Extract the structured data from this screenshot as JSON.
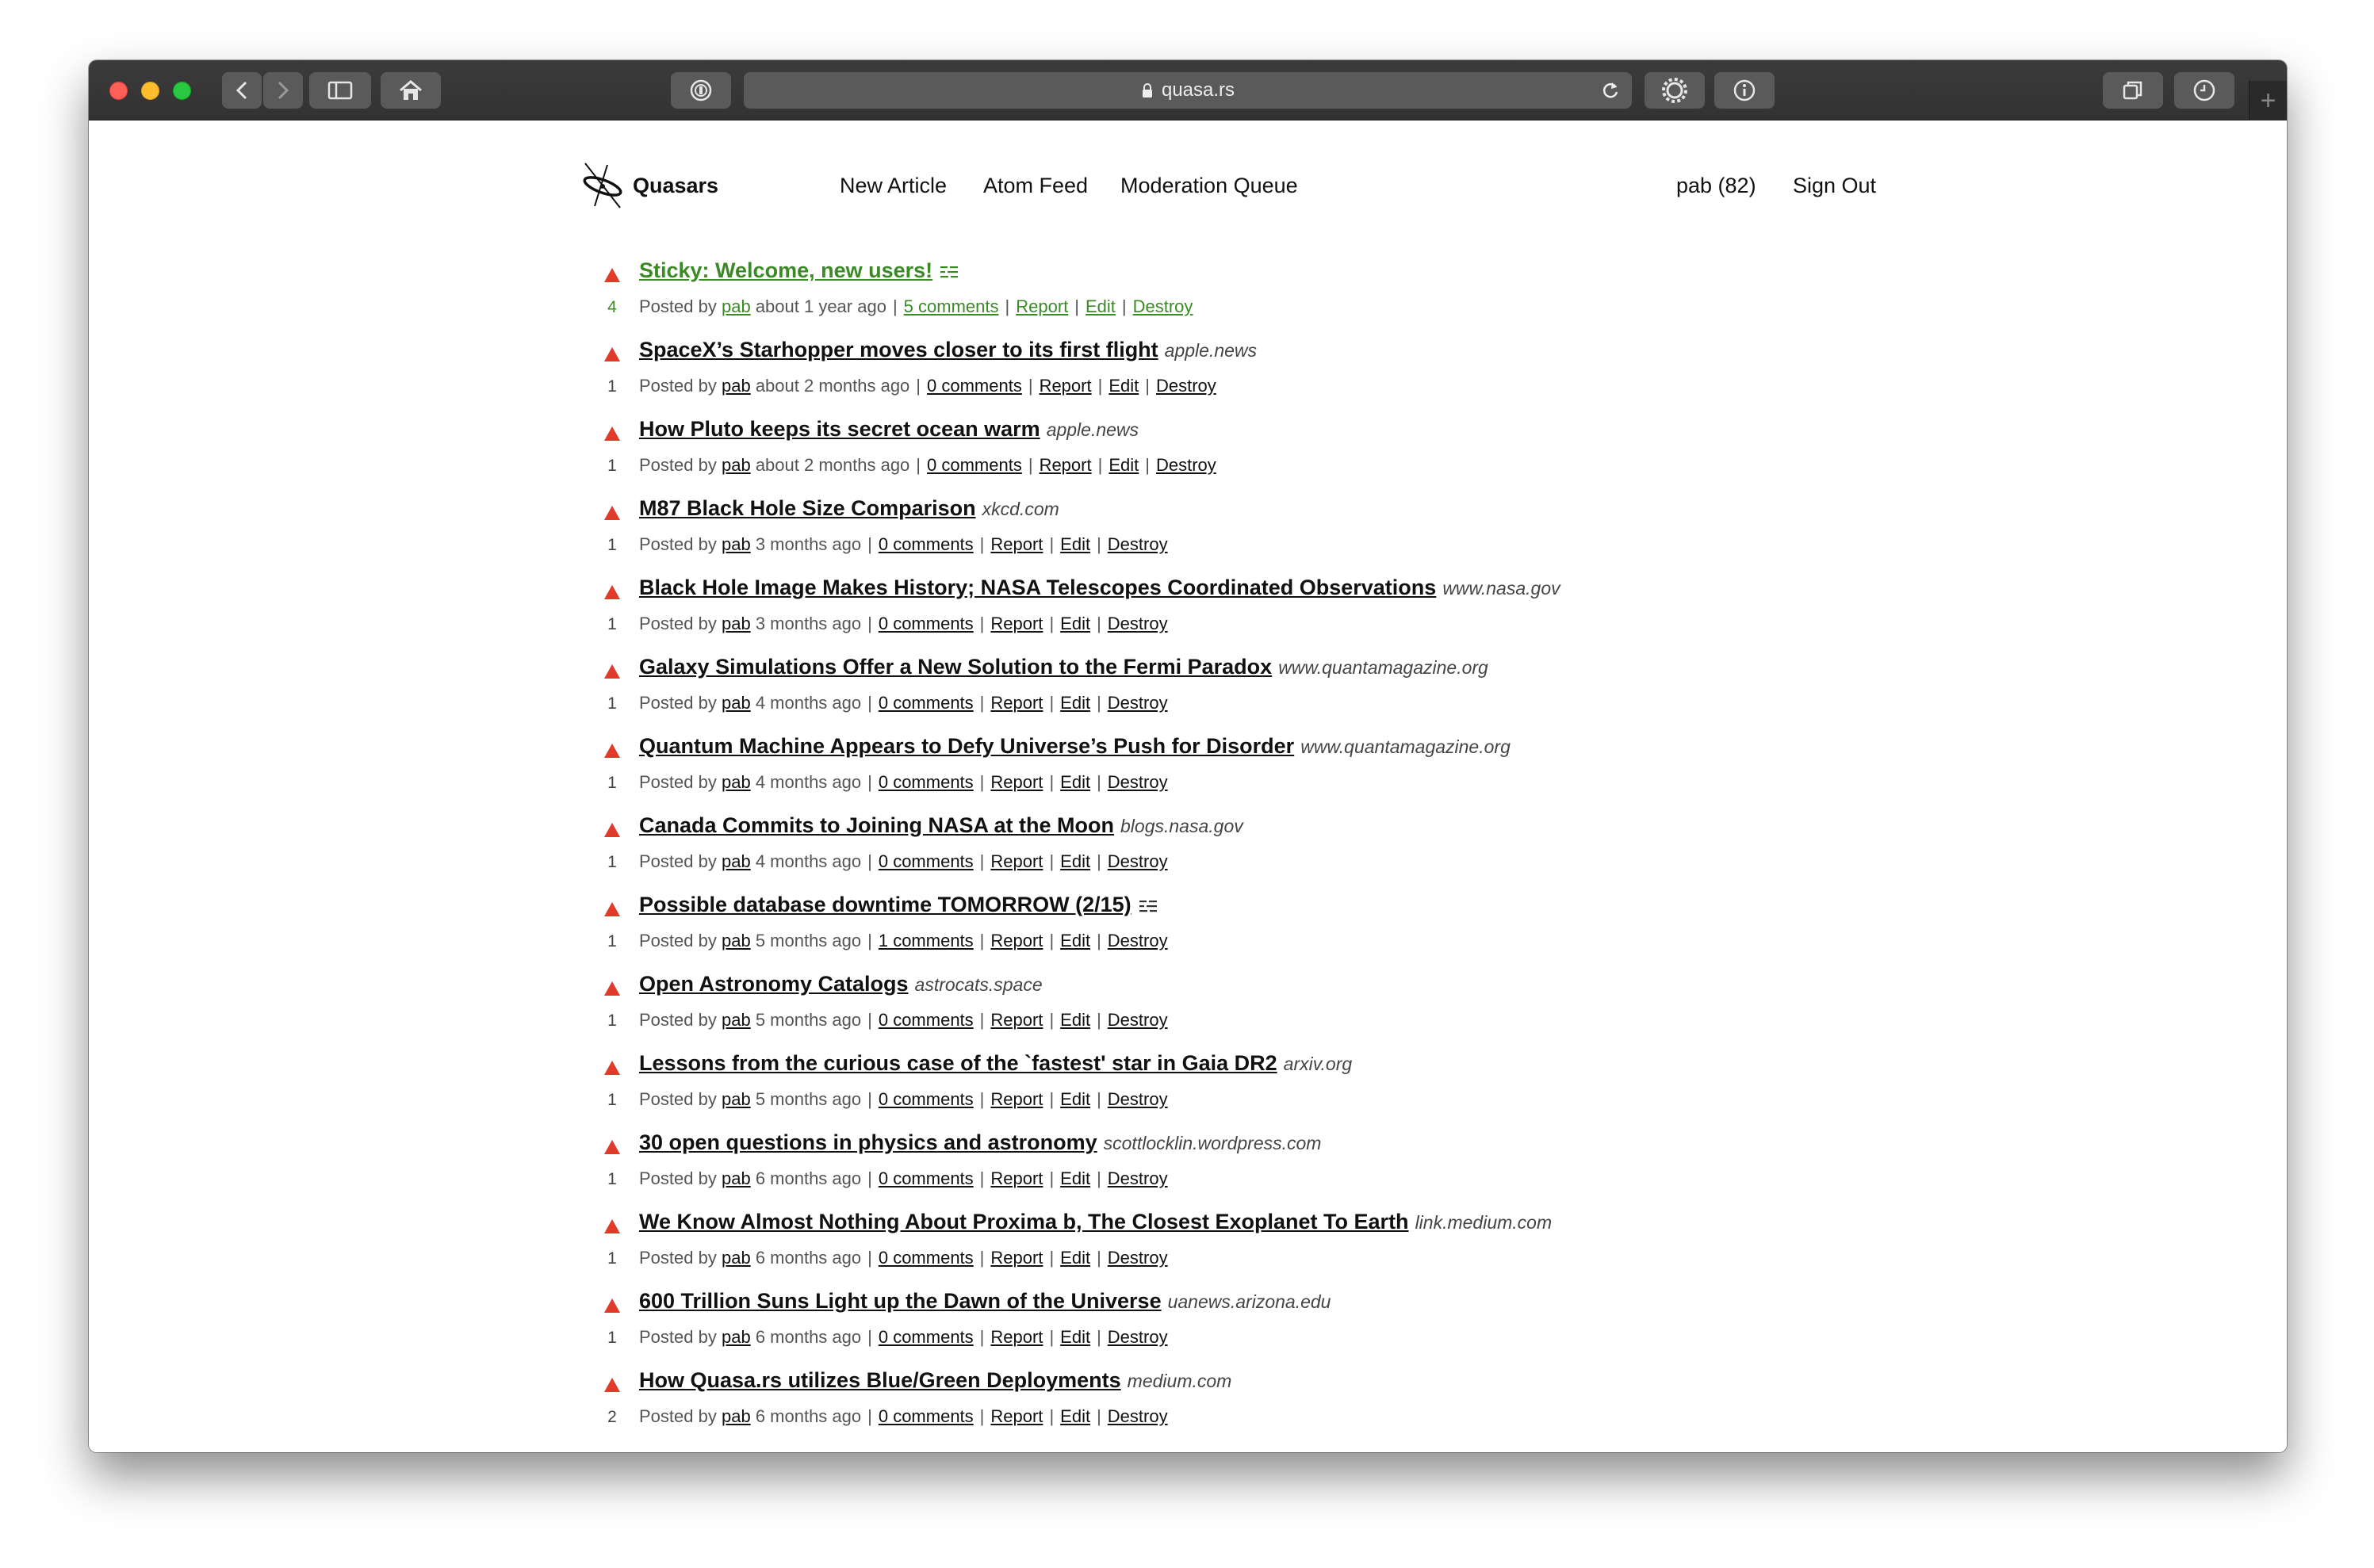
{
  "browser": {
    "url": "quasa.rs"
  },
  "nav": {
    "brand": "Quasars",
    "new_article": "New Article",
    "atom_feed": "Atom Feed",
    "moderation_queue": "Moderation Queue",
    "user": "pab (82)",
    "sign_out": "Sign Out"
  },
  "meta_labels": {
    "posted_by": "Posted by",
    "report": "Report",
    "edit": "Edit",
    "destroy": "Destroy",
    "separator": "|"
  },
  "stories": [
    {
      "score": "4",
      "title": "Sticky: Welcome, new users!",
      "domain": "",
      "text_post": true,
      "sticky": true,
      "author": "pab",
      "age": "about 1 year ago",
      "comments": "5 comments"
    },
    {
      "score": "1",
      "title": "SpaceX’s Starhopper moves closer to its first flight",
      "domain": "apple.news",
      "text_post": false,
      "sticky": false,
      "author": "pab",
      "age": "about 2 months ago",
      "comments": "0 comments"
    },
    {
      "score": "1",
      "title": "How Pluto keeps its secret ocean warm",
      "domain": "apple.news",
      "text_post": false,
      "sticky": false,
      "author": "pab",
      "age": "about 2 months ago",
      "comments": "0 comments"
    },
    {
      "score": "1",
      "title": "M87 Black Hole Size Comparison",
      "domain": "xkcd.com",
      "text_post": false,
      "sticky": false,
      "author": "pab",
      "age": "3 months ago",
      "comments": "0 comments"
    },
    {
      "score": "1",
      "title": "Black Hole Image Makes History; NASA Telescopes Coordinated Observations",
      "domain": "www.nasa.gov",
      "text_post": false,
      "sticky": false,
      "author": "pab",
      "age": "3 months ago",
      "comments": "0 comments"
    },
    {
      "score": "1",
      "title": "Galaxy Simulations Offer a New Solution to the Fermi Paradox",
      "domain": "www.quantamagazine.org",
      "text_post": false,
      "sticky": false,
      "author": "pab",
      "age": "4 months ago",
      "comments": "0 comments"
    },
    {
      "score": "1",
      "title": "Quantum Machine Appears to Defy Universe’s Push for Disorder",
      "domain": "www.quantamagazine.org",
      "text_post": false,
      "sticky": false,
      "author": "pab",
      "age": "4 months ago",
      "comments": "0 comments"
    },
    {
      "score": "1",
      "title": "Canada Commits to Joining NASA at the Moon",
      "domain": "blogs.nasa.gov",
      "text_post": false,
      "sticky": false,
      "author": "pab",
      "age": "4 months ago",
      "comments": "0 comments"
    },
    {
      "score": "1",
      "title": "Possible database downtime TOMORROW (2/15)",
      "domain": "",
      "text_post": true,
      "sticky": false,
      "author": "pab",
      "age": "5 months ago",
      "comments": "1 comments"
    },
    {
      "score": "1",
      "title": "Open Astronomy Catalogs",
      "domain": "astrocats.space",
      "text_post": false,
      "sticky": false,
      "author": "pab",
      "age": "5 months ago",
      "comments": "0 comments"
    },
    {
      "score": "1",
      "title": "Lessons from the curious case of the `fastest' star in Gaia DR2",
      "domain": "arxiv.org",
      "text_post": false,
      "sticky": false,
      "author": "pab",
      "age": "5 months ago",
      "comments": "0 comments"
    },
    {
      "score": "1",
      "title": "30 open questions in physics and astronomy",
      "domain": "scottlocklin.wordpress.com",
      "text_post": false,
      "sticky": false,
      "author": "pab",
      "age": "6 months ago",
      "comments": "0 comments"
    },
    {
      "score": "1",
      "title": "We Know Almost Nothing About Proxima b, The Closest Exoplanet To Earth",
      "domain": "link.medium.com",
      "text_post": false,
      "sticky": false,
      "author": "pab",
      "age": "6 months ago",
      "comments": "0 comments"
    },
    {
      "score": "1",
      "title": "600 Trillion Suns Light up the Dawn of the Universe",
      "domain": "uanews.arizona.edu",
      "text_post": false,
      "sticky": false,
      "author": "pab",
      "age": "6 months ago",
      "comments": "0 comments"
    },
    {
      "score": "2",
      "title": "How Quasa.rs utilizes Blue/Green Deployments",
      "domain": "medium.com",
      "text_post": false,
      "sticky": false,
      "author": "pab",
      "age": "6 months ago",
      "comments": "0 comments"
    }
  ]
}
